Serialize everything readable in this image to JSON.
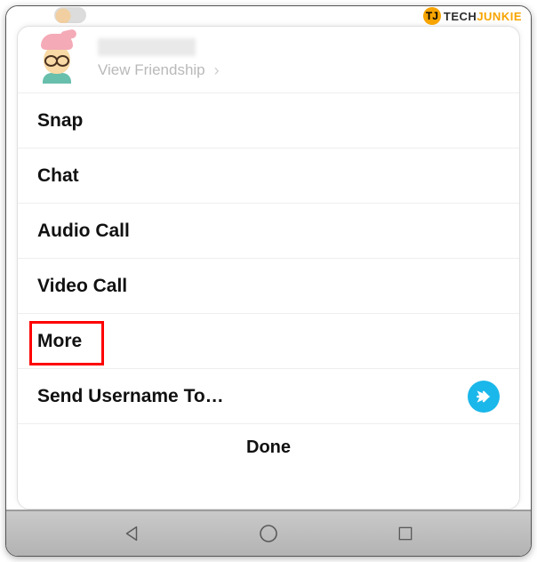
{
  "watermark": {
    "badge": "TJ",
    "brand_a": "TECH",
    "brand_b": "JUNKIE"
  },
  "profile": {
    "view_friendship": "View Friendship"
  },
  "menu": {
    "snap": "Snap",
    "chat": "Chat",
    "audio_call": "Audio Call",
    "video_call": "Video Call",
    "more": "More",
    "send_username": "Send Username To…"
  },
  "done": "Done",
  "icons": {
    "send": "send-icon",
    "chevron": "›"
  }
}
